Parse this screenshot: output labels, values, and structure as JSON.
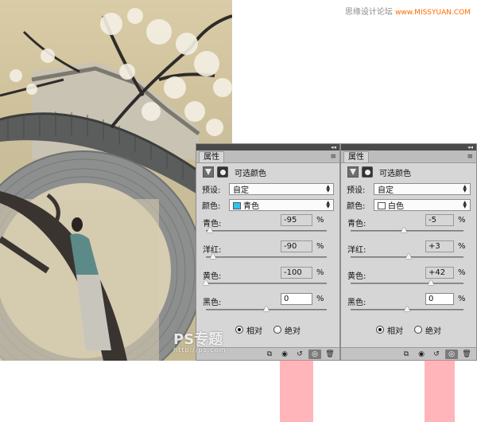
{
  "watermark": {
    "top_cn": "思缘设计论坛",
    "top_site": "www.MISSYUAN.COM",
    "bottom_logo": "PS专题",
    "bottom_url": "http://ps.com"
  },
  "panels": [
    {
      "tab": "属性",
      "adjustment_title": "可选颜色",
      "preset_label": "预设:",
      "preset_value": "自定",
      "color_label": "颜色:",
      "color_value": "青色",
      "color_swatch": "#2cc6f0",
      "sliders": [
        {
          "label": "青色:",
          "value": "-95",
          "pct": "%",
          "fraction": 0.03
        },
        {
          "label": "洋红:",
          "value": "-90",
          "pct": "%",
          "fraction": 0.06
        },
        {
          "label": "黄色:",
          "value": "-100",
          "pct": "%",
          "fraction": 0.0
        },
        {
          "label": "黑色:",
          "value": "0",
          "pct": "%",
          "fraction": 0.5
        }
      ],
      "radio_relative": "相对",
      "radio_absolute": "绝对",
      "mode": "relative"
    },
    {
      "tab": "属性",
      "adjustment_title": "可选颜色",
      "preset_label": "预设:",
      "preset_value": "自定",
      "color_label": "颜色:",
      "color_value": "白色",
      "color_swatch": "#ffffff",
      "sliders": [
        {
          "label": "青色:",
          "value": "-5",
          "pct": "%",
          "fraction": 0.475
        },
        {
          "label": "洋红:",
          "value": "+3",
          "pct": "%",
          "fraction": 0.515
        },
        {
          "label": "黄色:",
          "value": "+42",
          "pct": "%",
          "fraction": 0.71
        },
        {
          "label": "黑色:",
          "value": "0",
          "pct": "%",
          "fraction": 0.5
        }
      ],
      "radio_relative": "相对",
      "radio_absolute": "绝对",
      "mode": "relative"
    }
  ],
  "colors": {
    "highlight": "#ff7882",
    "panel_bg": "#d6d6d6"
  }
}
